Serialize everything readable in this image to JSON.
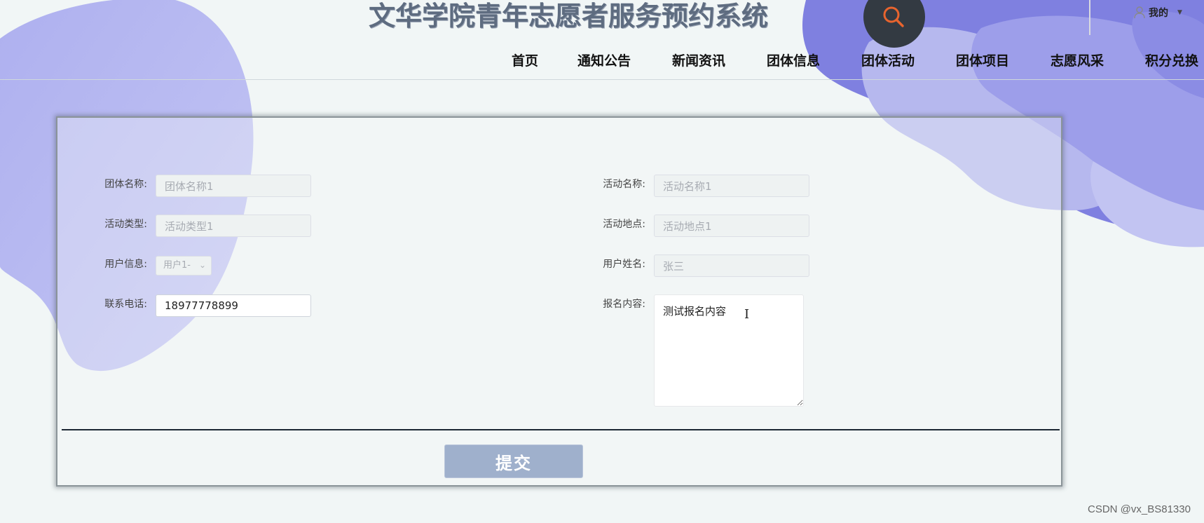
{
  "header": {
    "title": "文华学院青年志愿者服务预约系统",
    "user_menu_label": "我的",
    "search_icon": "search-icon",
    "accent_color": "#e8642e"
  },
  "nav": {
    "items": [
      "首页",
      "通知公告",
      "新闻资讯",
      "团体信息",
      "团体活动",
      "团体项目",
      "志愿风采",
      "积分兑换"
    ]
  },
  "form": {
    "group_name": {
      "label": "团体名称:",
      "value": "团体名称1"
    },
    "activity_name": {
      "label": "活动名称:",
      "value": "活动名称1"
    },
    "activity_type": {
      "label": "活动类型:",
      "value": "活动类型1"
    },
    "activity_location": {
      "label": "活动地点:",
      "value": "活动地点1"
    },
    "user_info": {
      "label": "用户信息:",
      "value": "用户1-"
    },
    "user_name": {
      "label": "用户姓名:",
      "value": "张三"
    },
    "phone": {
      "label": "联系电话:",
      "value": "18977778899"
    },
    "signup_content": {
      "label": "报名内容:",
      "value": "测试报名内容"
    },
    "submit_label": "提交"
  },
  "watermark": "CSDN @vx_BS81330",
  "colors": {
    "background": "#f1f6f6",
    "blob_light": "#c2c4f2",
    "blob_mid": "#9d9eea",
    "blob_dark": "#7f80e0",
    "submit_button": "#9fb0cc",
    "search_button": "#333a42"
  }
}
